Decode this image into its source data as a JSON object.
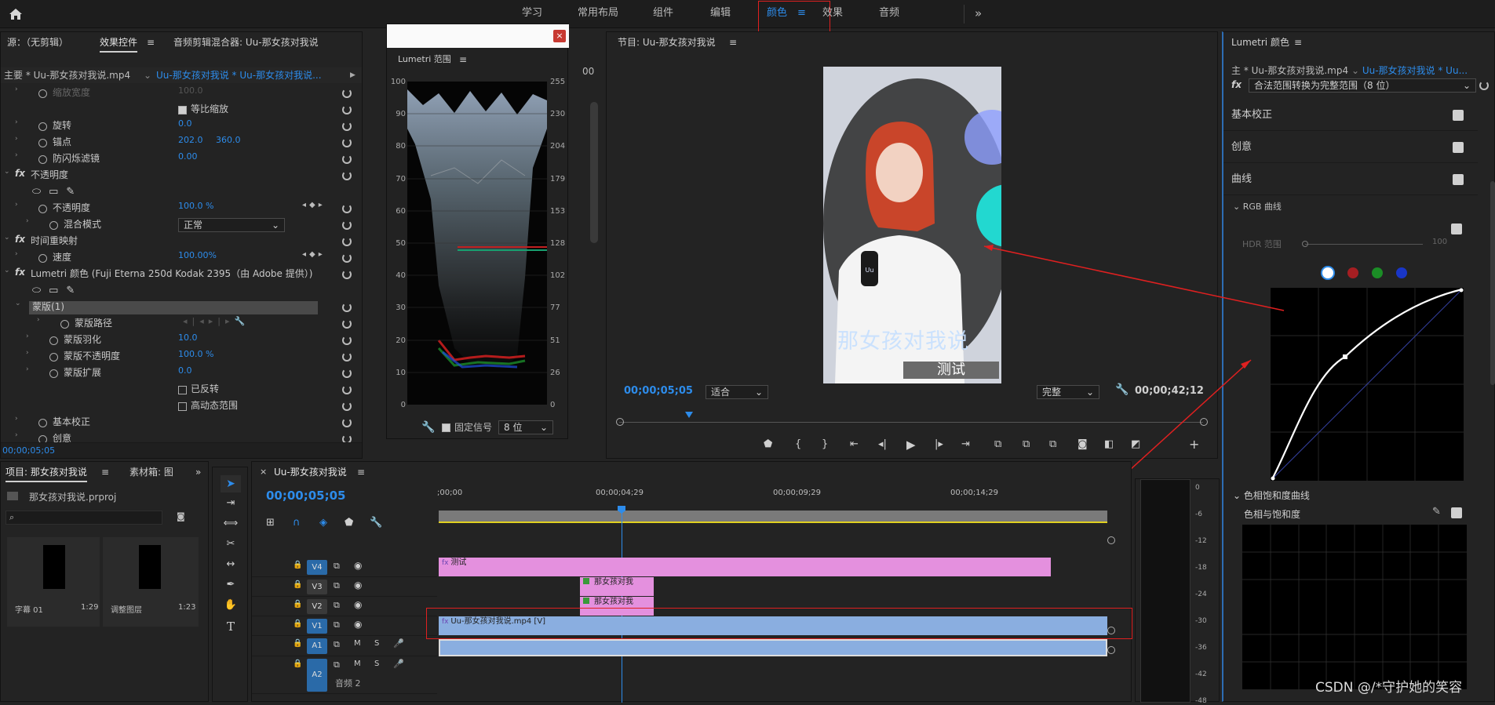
{
  "topbar": {
    "home_icon": "home-icon",
    "workspaces": [
      "学习",
      "常用布局",
      "组件",
      "编辑",
      "颜色",
      "效果",
      "音频"
    ],
    "active_workspace": "颜色",
    "more_icon": "double-chevron-right-icon",
    "menu_icon": "hamburger-icon"
  },
  "effect_panel": {
    "tab_source": "源：（无剪辑）",
    "tab_effects": "效果控件",
    "tab_audio": "音频剪辑混合器: Uu-那女孩对我说",
    "clip_path_main": "主要 * Uu-那女孩对我说.mp4",
    "clip_path_seq": "Uu-那女孩对我说 * Uu-那女孩对我说...",
    "ruler_time": ":00;00",
    "ruler_end": "00",
    "rows": [
      {
        "label": "缩放宽度",
        "value": "100.0",
        "dim": true,
        "indent": 1
      },
      {
        "label": "等比缩放",
        "value": "",
        "checkbox": true,
        "indent": 4
      },
      {
        "label": "旋转",
        "value": "0.0",
        "indent": 1
      },
      {
        "label": "锚点",
        "value": "202.0",
        "value2": "360.0",
        "indent": 1
      },
      {
        "label": "防闪烁滤镜",
        "value": "0.00",
        "indent": 1
      },
      {
        "label": "不透明度",
        "value": "",
        "fx": true,
        "indent": 0
      },
      {
        "label": "",
        "shapes": true,
        "indent": 2
      },
      {
        "label": "不透明度",
        "value": "100.0 %",
        "indent": 1,
        "keyframe": true
      },
      {
        "label": "混合模式",
        "value": "正常",
        "dropdown": true,
        "indent": 2
      },
      {
        "label": "时间重映射",
        "value": "",
        "fx": true,
        "indent": 0
      },
      {
        "label": "速度",
        "value": "100.00%",
        "indent": 1,
        "keyframe": true
      },
      {
        "label": "Lumetri 颜色 (Fuji Eterna 250d Kodak 2395（由 Adobe 提供）)",
        "value": "",
        "fx": true,
        "indent": 0
      },
      {
        "label": "",
        "shapes": true,
        "indent": 2
      },
      {
        "label": "蒙版(1)",
        "value": "",
        "highlight": true,
        "indent": 1
      },
      {
        "label": "蒙版路径",
        "value": "",
        "indent": 3,
        "mask_nav": true
      },
      {
        "label": "蒙版羽化",
        "value": "10.0",
        "indent": 2
      },
      {
        "label": "蒙版不透明度",
        "value": "100.0 %",
        "indent": 2
      },
      {
        "label": "蒙版扩展",
        "value": "0.0",
        "indent": 2
      },
      {
        "label": "已反转",
        "value": "",
        "checkbox": true,
        "indent": 5
      },
      {
        "label": "高动态范围",
        "value": "",
        "checkbox": true,
        "indent": 5
      },
      {
        "label": "基本校正",
        "value": "",
        "indent": 1
      },
      {
        "label": "创意",
        "value": "",
        "indent": 1
      }
    ],
    "footer_time": "00;00;05;05"
  },
  "scopes": {
    "title": "Lumetri 范围",
    "left_ticks": [
      "100",
      "90",
      "80",
      "70",
      "60",
      "50",
      "40",
      "30",
      "20",
      "10",
      "0"
    ],
    "right_ticks": [
      "255",
      "230",
      "204",
      "179",
      "153",
      "128",
      "102",
      "77",
      "51",
      "26",
      "0"
    ],
    "clamp_label": "固定信号",
    "bit_depth": "8 位"
  },
  "program": {
    "title": "节目: Uu-那女孩对我说",
    "timecode": "00;00;05;05",
    "fit": "适合",
    "quality": "完整",
    "duration": "00;00;42;12",
    "subtitle_text": "那女孩对我说",
    "caption_text": "测试",
    "mic_text": "Uu"
  },
  "lumetri": {
    "title": "Lumetri 颜色",
    "clip_main": "主 * Uu-那女孩对我说.mp4",
    "clip_seq": "Uu-那女孩对我说 * Uu...",
    "effect_preset": "合法范围转换为完整范围（8 位）",
    "sections": [
      "基本校正",
      "创意",
      "曲线"
    ],
    "rgb_curve_label": "RGB 曲线",
    "hdr_label": "HDR 范围",
    "hdr_value": "100",
    "hue_sat_section": "色相饱和度曲线",
    "hue_sat_label": "色相与饱和度",
    "colors": {
      "white": "#ffffff",
      "red": "#c0282a",
      "green": "#1d9a2a",
      "blue": "#1f3fd6"
    }
  },
  "project": {
    "tab_project": "项目: 那女孩对我说",
    "tab_bins": "素材箱: 图",
    "file_name": "那女孩对我说.prproj",
    "search_placeholder": "",
    "items": [
      {
        "name": "字幕 01",
        "dur": "1:29"
      },
      {
        "name": "调整图层",
        "dur": "1:23"
      }
    ]
  },
  "timeline": {
    "title": "Uu-那女孩对我说",
    "timecode": "00;00;05;05",
    "ruler": [
      ";00;00",
      "00;00;04;29",
      "00;00;09;29",
      "00;00;14;29"
    ],
    "tracks": [
      {
        "name": "V4",
        "type": "video"
      },
      {
        "name": "V3",
        "type": "video"
      },
      {
        "name": "V2",
        "type": "video"
      },
      {
        "name": "V1",
        "type": "video"
      },
      {
        "name": "A1",
        "type": "audio"
      },
      {
        "name": "A2",
        "type": "audio",
        "label": "音频 2"
      }
    ],
    "clips": [
      {
        "name": "测试",
        "track": "V4"
      },
      {
        "name": "那女孩对我",
        "track": "V3"
      },
      {
        "name": "那女孩对我",
        "track": "V2"
      },
      {
        "name": "Uu-那女孩对我说.mp4 [V]",
        "track": "V1"
      }
    ],
    "meter_ticks": [
      "0",
      "-6",
      "-12",
      "-18",
      "-24",
      "-30",
      "-36",
      "-42",
      "-48"
    ]
  },
  "watermark": "CSDN @/*守护她的笑容"
}
